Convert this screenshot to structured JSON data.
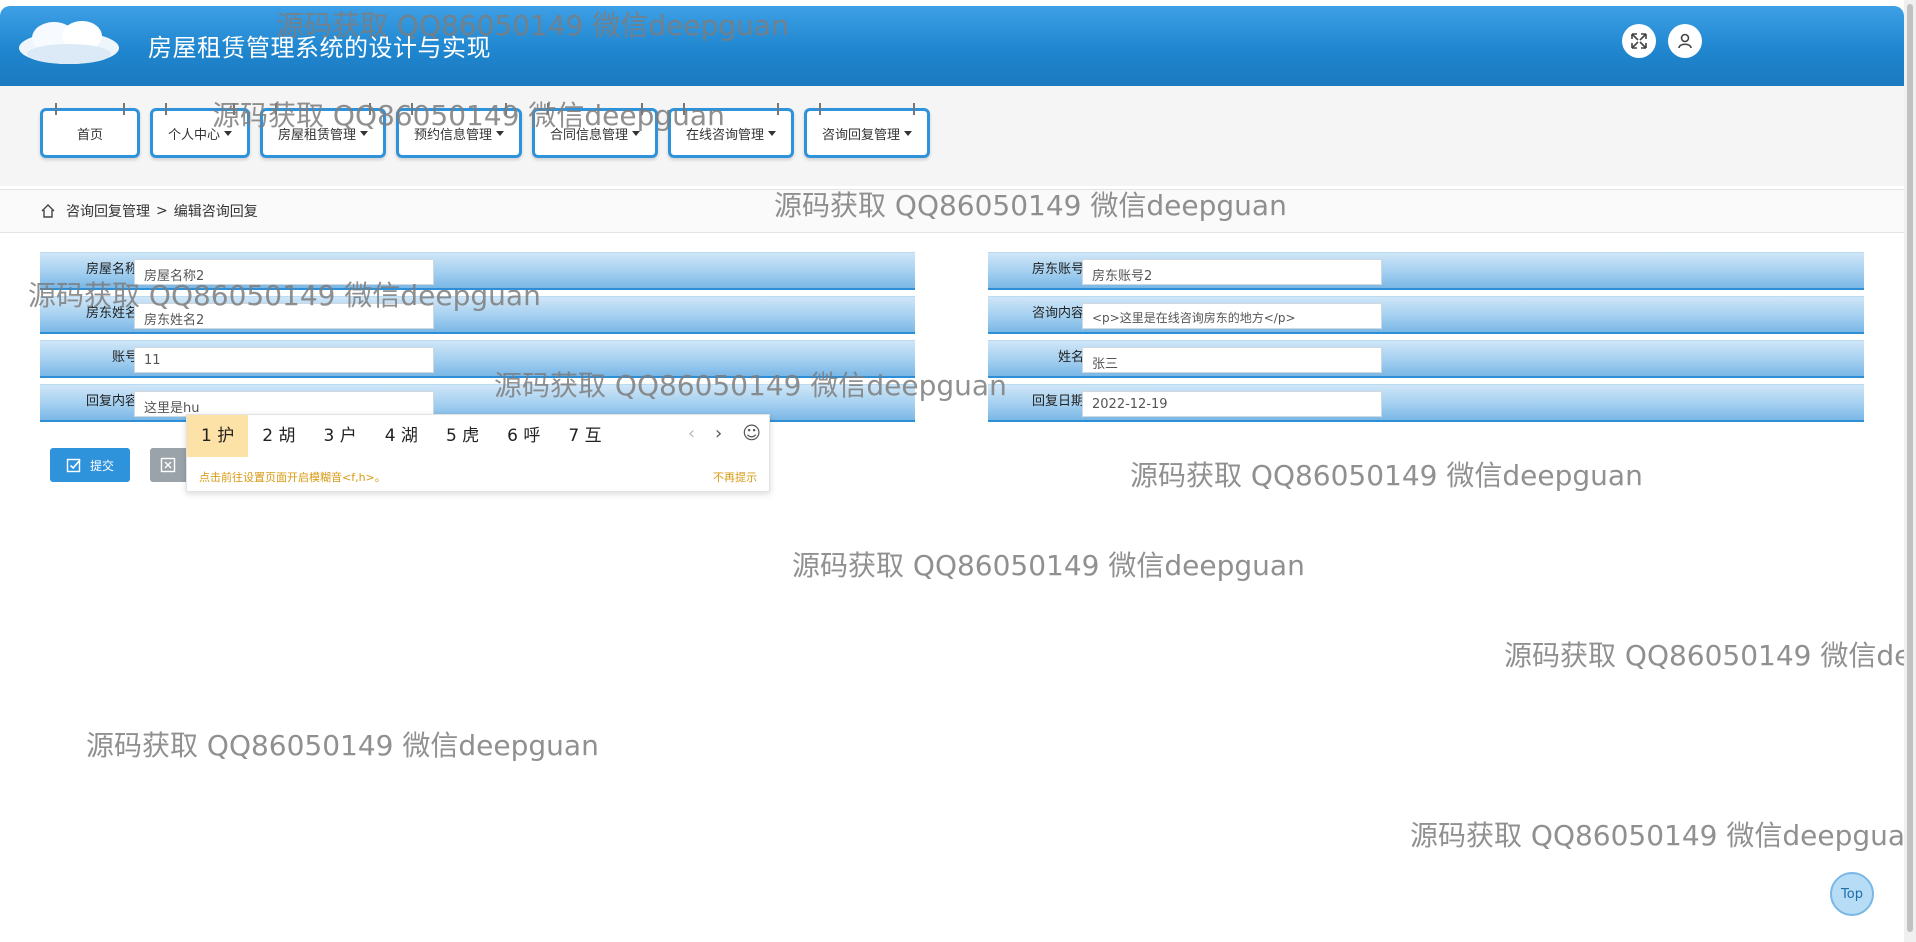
{
  "app": {
    "title": "房屋租赁管理系统的设计与实现"
  },
  "header": {
    "fullscreen_icon": "expand-icon",
    "user_icon": "user-icon"
  },
  "nav": [
    {
      "label": "首页",
      "dropdown": false
    },
    {
      "label": "个人中心",
      "dropdown": true
    },
    {
      "label": "房屋租赁管理",
      "dropdown": true
    },
    {
      "label": "预约信息管理",
      "dropdown": true
    },
    {
      "label": "合同信息管理",
      "dropdown": true
    },
    {
      "label": "在线咨询管理",
      "dropdown": true
    },
    {
      "label": "咨询回复管理",
      "dropdown": true
    }
  ],
  "breadcrumb": {
    "section": "咨询回复管理",
    "separator": ">",
    "page": "编辑咨询回复"
  },
  "form": {
    "house_name": {
      "label": "房屋名称",
      "value": "房屋名称2"
    },
    "landlord_name": {
      "label": "房东姓名",
      "value": "房东姓名2"
    },
    "account": {
      "label": "账号",
      "value": "11"
    },
    "reply_content": {
      "label": "回复内容",
      "value": "这里是hu"
    },
    "landlord_account": {
      "label": "房东账号",
      "value": "房东账号2"
    },
    "consult_content": {
      "label": "咨询内容",
      "value": "<p>这里是在线咨询房东的地方</p>"
    },
    "name": {
      "label": "姓名",
      "value": "张三"
    },
    "reply_date": {
      "label": "回复日期",
      "value": "2022-12-19"
    }
  },
  "buttons": {
    "submit": "提交"
  },
  "ime": {
    "candidates": [
      "1 护",
      "2 胡",
      "3 户",
      "4 湖",
      "5 虎",
      "6 呼",
      "7 互"
    ],
    "tip": "点击前往设置页面开启模糊音<f,h>。",
    "dismiss": "不再提示"
  },
  "watermark": "源码获取 QQ86050149 微信deepguan",
  "top_button": "Top"
}
